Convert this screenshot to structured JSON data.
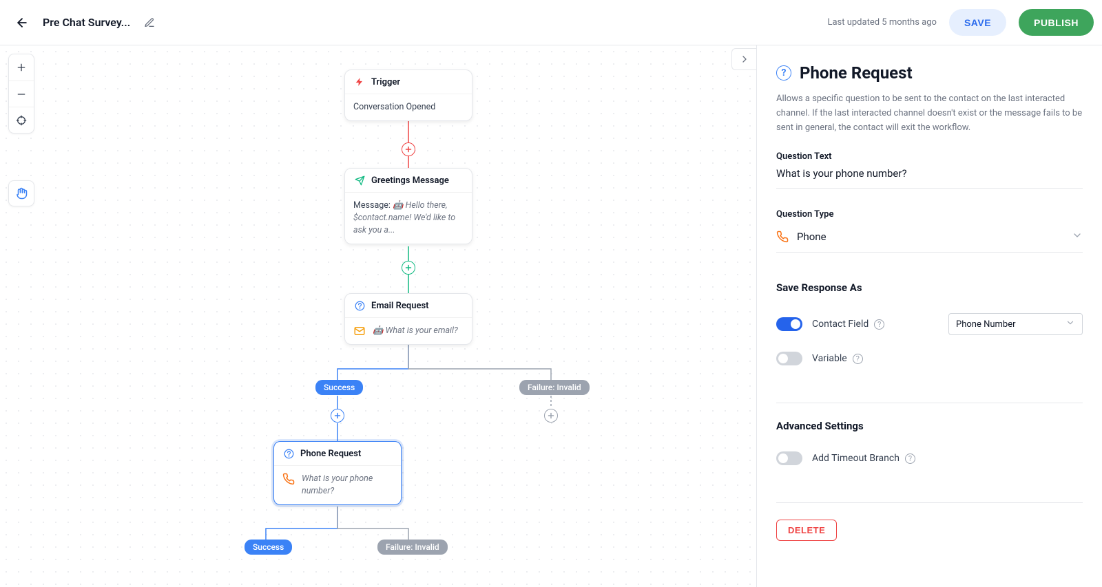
{
  "header": {
    "title": "Pre Chat Survey...",
    "last_updated": "Last updated 5 months ago",
    "save_label": "SAVE",
    "publish_label": "PUBLISH"
  },
  "canvas": {
    "trigger": {
      "title": "Trigger",
      "body": "Conversation Opened"
    },
    "greetings": {
      "title": "Greetings Message",
      "msg_label": "Message:",
      "msg_text": " 🤖 Hello there, $contact.name! We'd like to ask you a..."
    },
    "email": {
      "title": "Email Request",
      "question": "🤖 What is your email?"
    },
    "phone": {
      "title": "Phone Request",
      "question": "What is your phone number?"
    },
    "pills": {
      "success": "Success",
      "failure_invalid": "Failure: Invalid"
    }
  },
  "sidebar": {
    "title": "Phone Request",
    "description": "Allows a specific question to be sent to the contact on the last interacted channel. If the last interacted channel doesn't exist or the message fails to be sent in general, the contact will exit the workflow.",
    "question_text_label": "Question Text",
    "question_text_value": "What is your phone number?",
    "question_type_label": "Question Type",
    "question_type_value": "Phone",
    "save_response_heading": "Save Response As",
    "contact_field_label": "Contact Field",
    "contact_field_select": "Phone Number",
    "variable_label": "Variable",
    "advanced_heading": "Advanced Settings",
    "timeout_label": "Add Timeout Branch",
    "delete_label": "DELETE"
  }
}
